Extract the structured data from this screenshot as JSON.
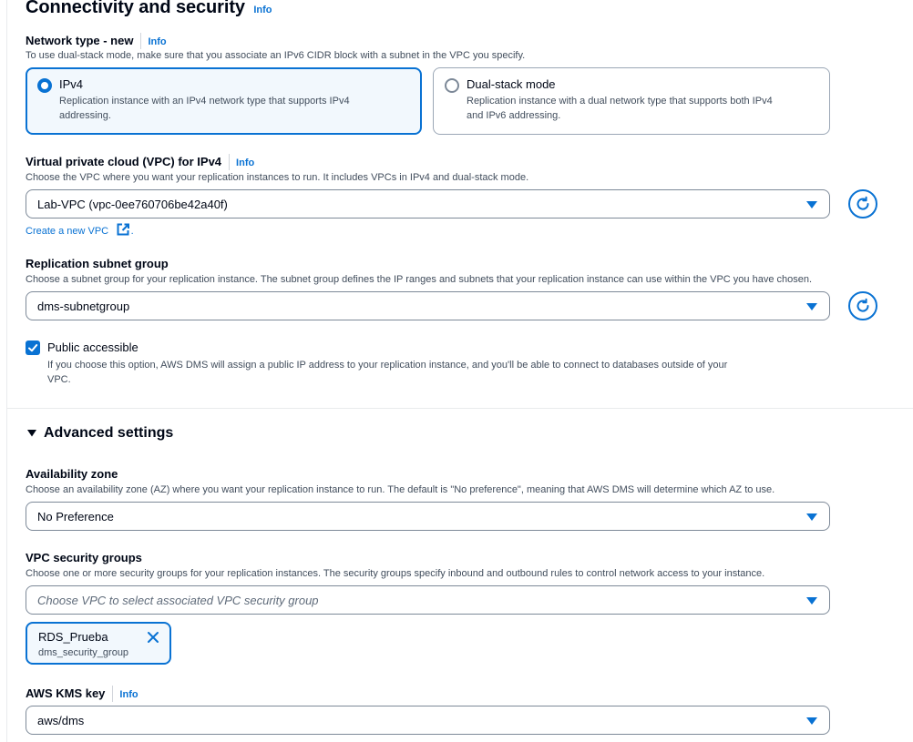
{
  "section": {
    "title": "Connectivity and security",
    "info": "Info"
  },
  "network_type": {
    "label": "Network type - new",
    "info": "Info",
    "description": "To use dual-stack mode, make sure that you associate an IPv6 CIDR block with a subnet in the VPC you specify.",
    "options": [
      {
        "title": "IPv4",
        "description_line1": "Replication instance with an IPv4 network type that supports IPv4",
        "description_line2": "addressing.",
        "selected": true
      },
      {
        "title": "Dual-stack mode",
        "description_line1": "Replication instance with a dual network type that supports both IPv4",
        "description_line2": "and IPv6 addressing.",
        "selected": false
      }
    ]
  },
  "vpc": {
    "label": "Virtual private cloud (VPC) for IPv4",
    "info": "Info",
    "description": "Choose the VPC where you want your replication instances to run. It includes VPCs in IPv4 and dual-stack mode.",
    "value": "Lab-VPC (vpc-0ee760706be42a40f)",
    "create_link": "Create a new VPC",
    "refresh_icon": "refresh-icon"
  },
  "subnet_group": {
    "label": "Replication subnet group",
    "description": "Choose a subnet group for your replication instance. The subnet group defines the IP ranges and subnets that your replication instance can use within the VPC you have chosen.",
    "value": "dms-subnetgroup",
    "refresh_icon": "refresh-icon"
  },
  "public_accessible": {
    "label": "Public accessible",
    "checked": true,
    "description_line1": "If you choose this option, AWS DMS will assign a public IP address to your replication instance, and you'll be able to connect to databases outside of your",
    "description_line2": "VPC."
  },
  "advanced": {
    "title": "Advanced settings",
    "expanded": true
  },
  "availability_zone": {
    "label": "Availability zone",
    "description": "Choose an availability zone (AZ) where you want your replication instance to run. The default is \"No preference\", meaning that AWS DMS will determine which AZ to use.",
    "value": "No Preference"
  },
  "security_groups": {
    "label": "VPC security groups",
    "description": "Choose one or more security groups for your replication instances. The security groups specify inbound and outbound rules to control network access to your instance.",
    "placeholder": "Choose VPC to select associated VPC security group",
    "tokens": [
      {
        "name": "RDS_Prueba",
        "description": "dms_security_group"
      }
    ]
  },
  "kms_key": {
    "label": "AWS KMS key",
    "info": "Info",
    "value": "aws/dms"
  },
  "colors": {
    "accent": "#0972d3",
    "text": "#000716",
    "secondary_text": "#414d5c",
    "border": "#7d8998"
  }
}
